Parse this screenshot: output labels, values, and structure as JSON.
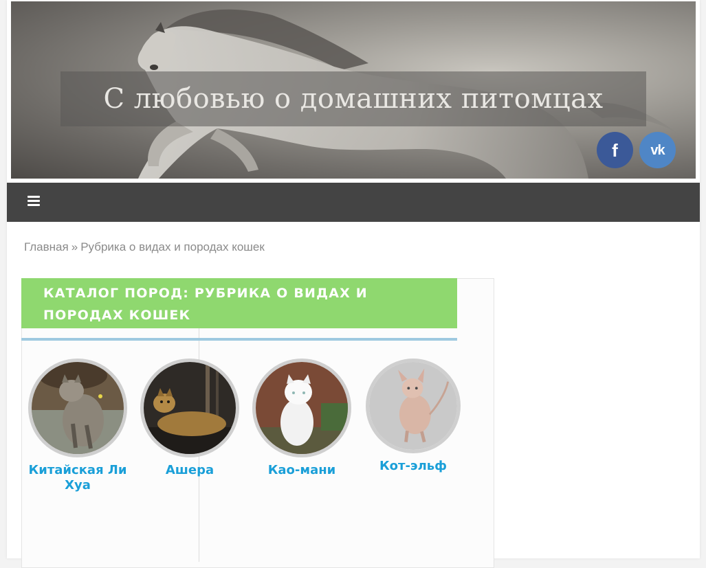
{
  "header": {
    "site_title": "С любовью о домашних питомцах",
    "social": [
      {
        "name": "facebook",
        "glyph": "f",
        "color": "#3b5998"
      },
      {
        "name": "vk",
        "glyph": "vk",
        "color": "#4f86c6"
      }
    ]
  },
  "nav": {
    "menu_icon": "hamburger-icon",
    "background": "#444444"
  },
  "breadcrumb": {
    "home": "Главная",
    "separator": "»",
    "current": "Рубрика о видах и породах кошек"
  },
  "catalog": {
    "title": "Каталог пород: Рубрика о видах и породах кошек",
    "header_color": "#8fd86f",
    "rule_color": "#9ec9e0",
    "breeds": [
      {
        "name": "Китайская Ли Хуа"
      },
      {
        "name": "Ашера"
      },
      {
        "name": "Као-мани"
      },
      {
        "name": "Кот-эльф"
      }
    ],
    "link_color": "#1a9fd8"
  }
}
